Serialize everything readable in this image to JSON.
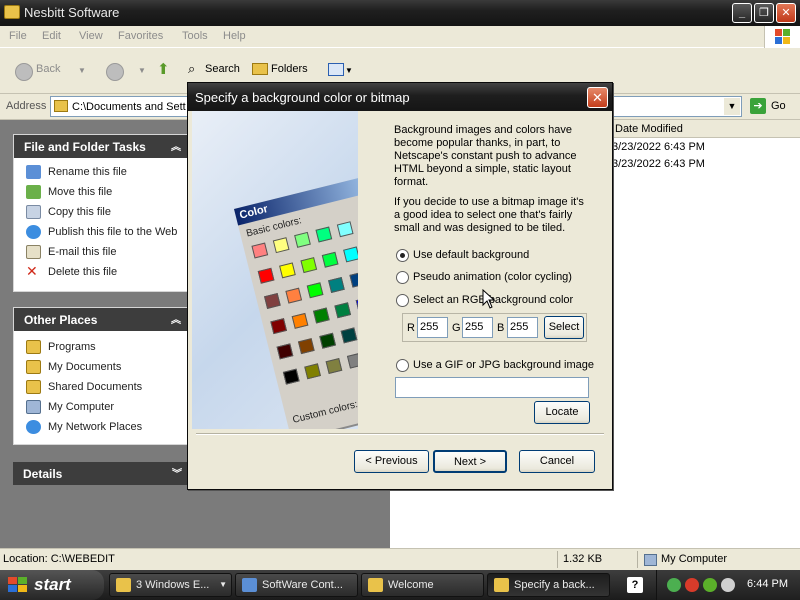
{
  "window": {
    "title": "Nesbitt Software"
  },
  "menu": [
    "File",
    "Edit",
    "View",
    "Favorites",
    "Tools",
    "Help"
  ],
  "toolbar": {
    "back": "Back",
    "search": "Search",
    "folders": "Folders"
  },
  "address": {
    "label": "Address",
    "value": "C:\\Documents and Sett",
    "go": "Go"
  },
  "tasks": {
    "file_tasks_title": "File and Folder Tasks",
    "file_tasks": [
      "Rename this file",
      "Move this file",
      "Copy this file",
      "Publish this file to the Web",
      "E-mail this file",
      "Delete this file"
    ],
    "other_places_title": "Other Places",
    "other_places": [
      "Programs",
      "My Documents",
      "Shared Documents",
      "My Computer",
      "My Network Places"
    ],
    "details_title": "Details"
  },
  "files": {
    "column": "Date Modified",
    "rows": [
      "3/23/2022 6:43 PM",
      "3/23/2022 6:43 PM"
    ]
  },
  "status": {
    "location": "Location: C:\\WEBEDIT",
    "size": "1.32 KB",
    "computer": "My Computer"
  },
  "taskbar": {
    "start": "start",
    "items": [
      "3 Windows E...",
      "SoftWare Cont...",
      "Welcome",
      "Specify a back..."
    ],
    "clock": "6:44 PM"
  },
  "dialog": {
    "title": "Specify a background color or bitmap",
    "desc1": "Background images and colors have become popular thanks, in part, to Netscape's constant push to advance HTML beyond a simple, static layout format.",
    "desc2": "If you decide to use a bitmap image it's a good idea to select one that's fairly small and was designed to be tiled.",
    "options": [
      "Use default background",
      "Pseudo animation (color cycling)",
      "Select an RGB background color",
      "Use a GIF or JPG background image"
    ],
    "selected_option": 0,
    "rgb": {
      "r_label": "R",
      "g_label": "G",
      "b_label": "B",
      "r": "255",
      "g": "255",
      "b": "255",
      "select": "Select"
    },
    "image_path": "",
    "locate": "Locate",
    "buttons": {
      "previous": "< Previous",
      "next": "Next >",
      "cancel": "Cancel"
    },
    "illustration": {
      "title": "Color",
      "basic": "Basic colors:",
      "custom": "Custom colors:"
    }
  }
}
